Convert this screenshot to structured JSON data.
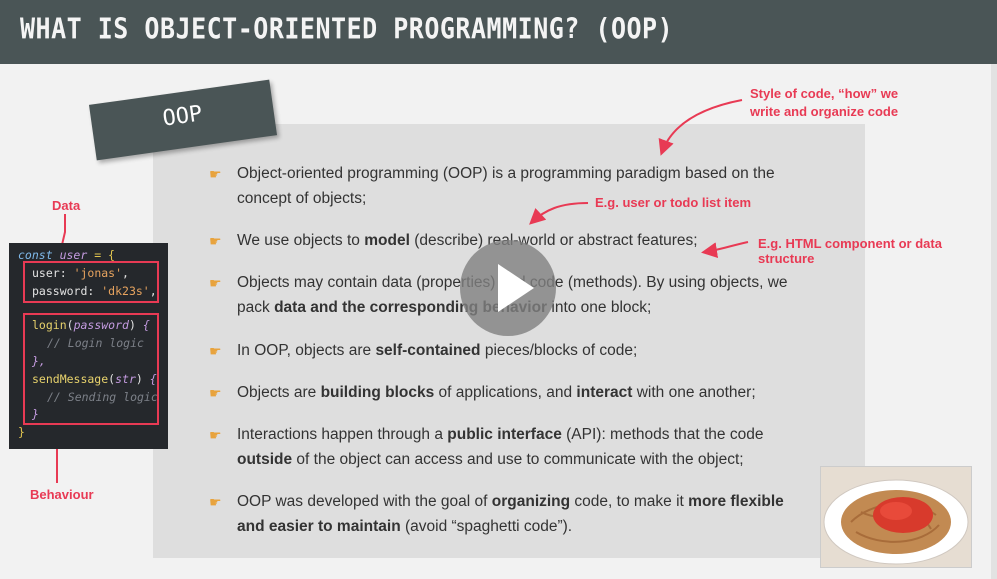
{
  "header": {
    "title": "WHAT IS OBJECT-ORIENTED PROGRAMMING? (OOP)"
  },
  "tag": {
    "label": "OOP"
  },
  "annotations": {
    "style": [
      "Style of code, “how” we",
      "write and organize code"
    ],
    "eg_user": "E.g. user or todo list item",
    "eg_html": "E.g. HTML component or data structure",
    "data": "Data",
    "behaviour": "Behaviour"
  },
  "bullets": [
    {
      "lines": [
        [
          {
            "t": "Object-oriented programming (OOP) is a programming paradigm based on the"
          }
        ],
        [
          {
            "t": "concept of objects;"
          }
        ]
      ]
    },
    {
      "lines": [
        [
          {
            "t": "We use objects to "
          },
          {
            "t": "model",
            "b": true
          },
          {
            "t": " (describe) real-world or abstract features;"
          }
        ]
      ]
    },
    {
      "lines": [
        [
          {
            "t": "Objects may contain data (properties) and code (methods). By using objects, we"
          }
        ],
        [
          {
            "t": "pack "
          },
          {
            "t": "data and the corresponding behavior",
            "b": true
          },
          {
            "t": " into one block;"
          }
        ]
      ]
    },
    {
      "lines": [
        [
          {
            "t": "In OOP, objects are "
          },
          {
            "t": "self-contained",
            "b": true
          },
          {
            "t": " pieces/blocks of code;"
          }
        ]
      ]
    },
    {
      "lines": [
        [
          {
            "t": "Objects are "
          },
          {
            "t": "building blocks",
            "b": true
          },
          {
            "t": " of applications, and "
          },
          {
            "t": "interact",
            "b": true
          },
          {
            "t": " with one another;"
          }
        ]
      ]
    },
    {
      "lines": [
        [
          {
            "t": "Interactions happen through a "
          },
          {
            "t": "public interface",
            "b": true
          },
          {
            "t": " (API): methods that the code"
          }
        ],
        [
          {
            "t": "outside",
            "b": true
          },
          {
            "t": " of the object can access and use to communicate with the object;"
          }
        ]
      ]
    },
    {
      "lines": [
        [
          {
            "t": "OOP was developed with the goal of "
          },
          {
            "t": "organizing",
            "b": true
          },
          {
            "t": " code, to make it "
          },
          {
            "t": "more flexible",
            "b": true
          }
        ],
        [
          {
            "t": "and easier to maintain",
            "b": true
          },
          {
            "t": " (avoid “spaghetti code”)."
          }
        ]
      ]
    }
  ],
  "code": {
    "line1": {
      "kw": "const",
      "var": "user",
      "rest": " = {"
    },
    "line2": {
      "key": "user",
      "str": "'jonas'"
    },
    "line3": {
      "key": "password",
      "str": "'dk23s'"
    },
    "line4": {
      "fn": "login",
      "arg": "password"
    },
    "line5": "// Login logic",
    "line6": "},",
    "line7": {
      "fn": "sendMessage",
      "arg": "str"
    },
    "line8": "// Sending logic",
    "line9": "}",
    "line10": "}"
  },
  "colors": {
    "header": "#4a5556",
    "accent": "#e83a54",
    "panel": "#dedede",
    "hand": "#e8a33d"
  },
  "icons": {
    "bullet": "pointing-hand-icon",
    "play": "play-icon"
  }
}
